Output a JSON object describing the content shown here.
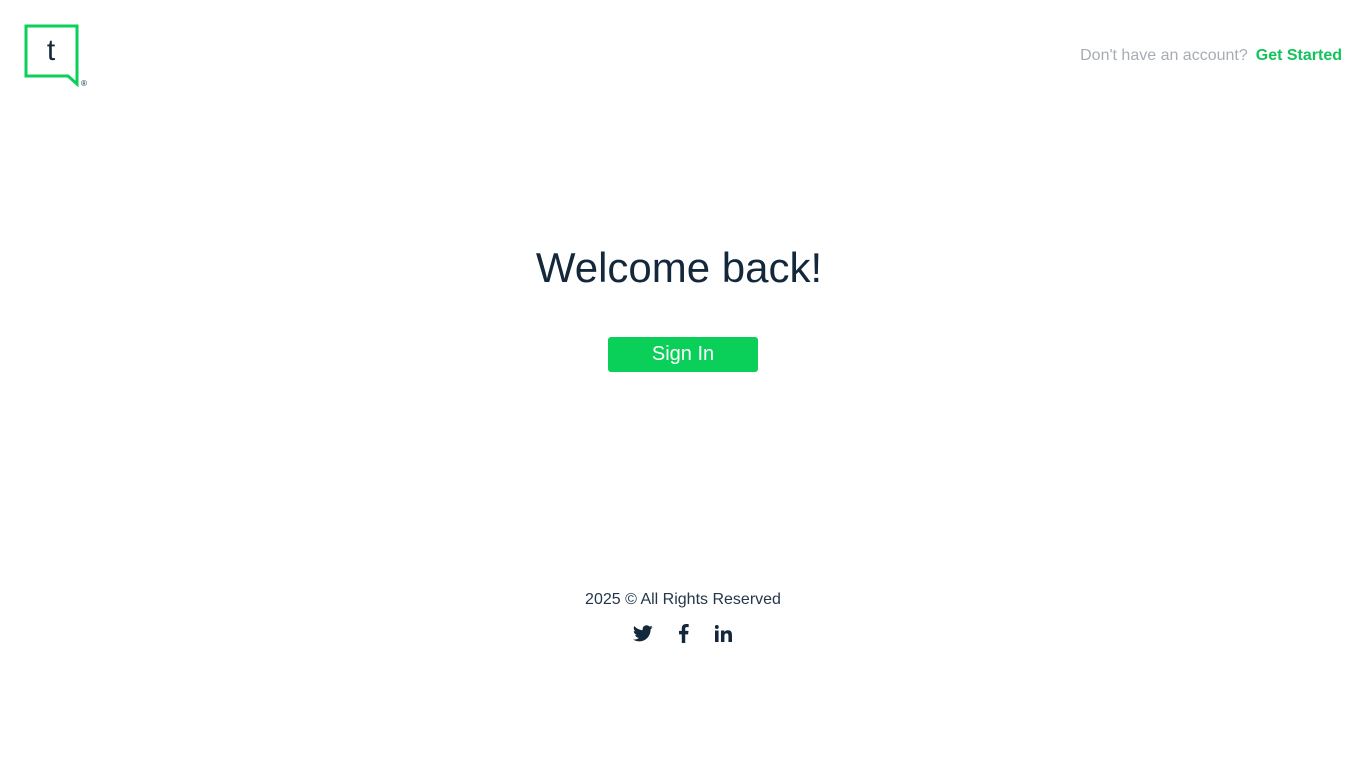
{
  "header": {
    "logo_letter": "t",
    "logo_mark": "®",
    "account_prompt": "Don't have an account?",
    "get_started_label": "Get Started"
  },
  "main": {
    "title": "Welcome back!",
    "sign_in_label": "Sign In"
  },
  "footer": {
    "copyright": "2025 © All Rights Reserved",
    "social": [
      {
        "name": "twitter",
        "icon": "twitter-icon"
      },
      {
        "name": "facebook",
        "icon": "facebook-icon"
      },
      {
        "name": "linkedin",
        "icon": "linkedin-icon"
      }
    ]
  },
  "colors": {
    "brand_green": "#0ad05a",
    "link_green": "#12c35b",
    "heading_navy": "#13283b",
    "muted_gray": "#a7adb3",
    "icon_navy": "#13283b"
  }
}
